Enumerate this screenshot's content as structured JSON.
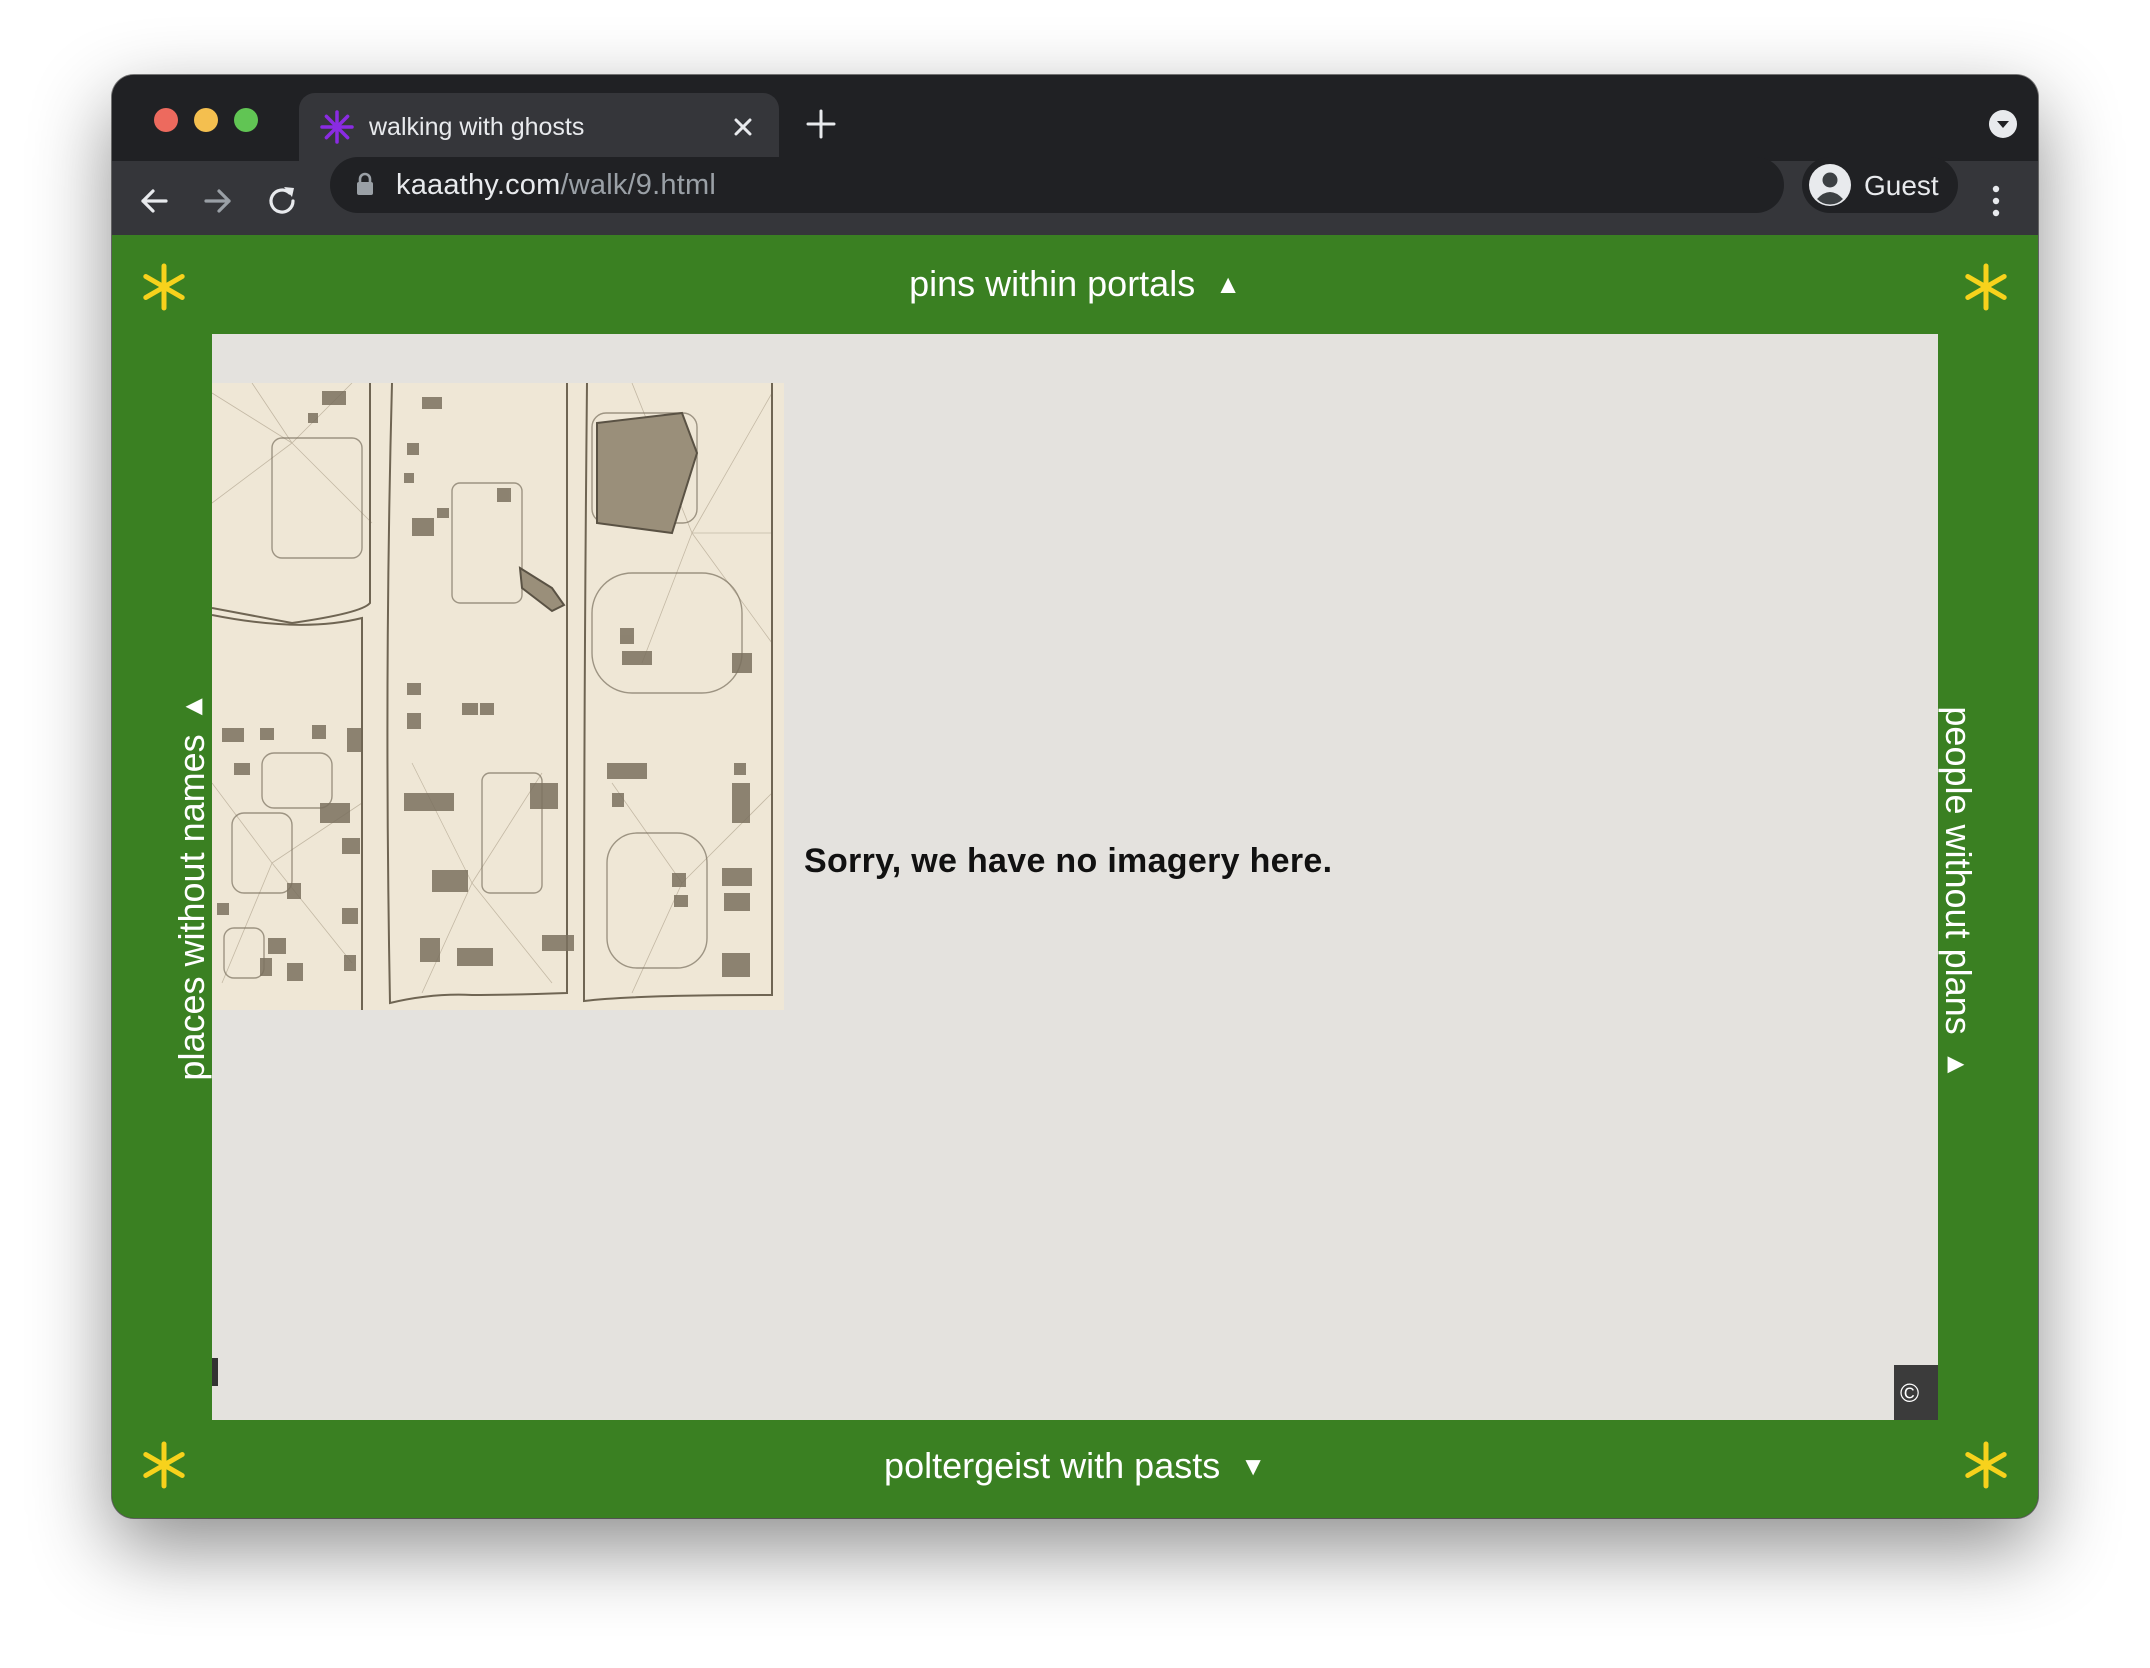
{
  "browser": {
    "tab": {
      "title": "walking with ghosts",
      "favicon": "asterisk-icon"
    },
    "url": {
      "host": "kaaathy.com",
      "path": "/walk/9.html"
    },
    "profile": {
      "label": "Guest"
    }
  },
  "page": {
    "nav_top": "pins within portals",
    "nav_top_arrow": "▲",
    "nav_bottom": "poltergeist with pasts",
    "nav_bottom_arrow": "▼",
    "nav_left": "places without names",
    "nav_left_arrow": "◀",
    "nav_right": "people without plans",
    "nav_right_arrow": "▶",
    "map": {
      "message": "Sorry, we have no imagery here.",
      "copyright": "©"
    },
    "colors": {
      "background": "#3a8022",
      "star": "#f7d21c",
      "map_bg": "#e4e2de"
    }
  }
}
